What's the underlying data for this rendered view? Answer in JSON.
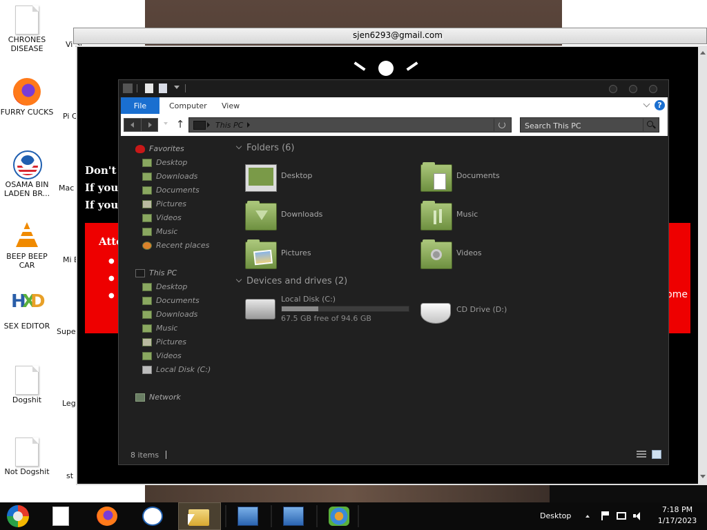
{
  "desktop": {
    "icons": [
      {
        "label": "CHRONES DISEASE",
        "icon": "document-icon"
      },
      {
        "label": "FURRY CUCKS",
        "icon": "firefox-icon"
      },
      {
        "label": "OSAMA BIN LADEN BR...",
        "icon": "obama-logo-icon"
      },
      {
        "label": "BEEP BEEP CAR",
        "icon": "vlc-cone-icon"
      },
      {
        "label": "SEX EDITOR",
        "icon": "hxd-icon"
      },
      {
        "label": "Dogshit",
        "icon": "document-icon"
      },
      {
        "label": "Not Dogshit",
        "icon": "document-icon"
      }
    ],
    "partial_icons": [
      {
        "label": "Vi St",
        "icon": "document-icon"
      },
      {
        "label": "Pi Chi",
        "icon": "image-icon"
      },
      {
        "label": "Mac IN",
        "icon": "app-icon"
      },
      {
        "label": "Mi E",
        "icon": "app-icon"
      },
      {
        "label": "Supe",
        "icon": "document-icon"
      },
      {
        "label": "Leg Ch",
        "icon": "document-icon"
      },
      {
        "label": "st ur",
        "icon": "app-icon"
      }
    ]
  },
  "ransom_window": {
    "title": "sjen6293@gmail.com",
    "lines": [
      "Don't w",
      "If you",
      "If you"
    ],
    "red_box_heading": "Atte",
    "red_box_right_text": "ome",
    "colors": {
      "background": "#000000",
      "box": "#ee0000"
    }
  },
  "explorer": {
    "ribbon": {
      "tabs": [
        "File",
        "Computer",
        "View"
      ],
      "help": "?"
    },
    "address": {
      "location": "This PC"
    },
    "search": {
      "placeholder": "Search This PC"
    },
    "nav": {
      "favorites_label": "Favorites",
      "favorites": [
        "Desktop",
        "Downloads",
        "Documents",
        "Pictures",
        "Videos",
        "Music",
        "Recent places"
      ],
      "thispc_label": "This PC",
      "thispc": [
        "Desktop",
        "Documents",
        "Downloads",
        "Music",
        "Pictures",
        "Videos",
        "Local Disk (C:)"
      ],
      "network_label": "Network"
    },
    "folders_header": "Folders (6)",
    "folders": [
      "Desktop",
      "Documents",
      "Downloads",
      "Music",
      "Pictures",
      "Videos"
    ],
    "drives_header": "Devices and drives (2)",
    "drives": [
      {
        "name": "Local Disk (C:)",
        "free": "67.5 GB free of 94.6 GB",
        "used_fraction": 0.286
      },
      {
        "name": "CD Drive (D:)"
      }
    ],
    "status": {
      "count": "8 items"
    },
    "colors": {
      "accent": "#1a6fd0",
      "window_bg": "#202020"
    }
  },
  "taskbar": {
    "items": [
      "start-icon",
      "document-icon",
      "firefox-icon",
      "obama-logo-icon",
      "file-explorer-icon",
      "network-setup-icon",
      "network-setup-icon",
      "network-gears-icon"
    ],
    "active_item": "file-explorer-icon",
    "desktop_label": "Desktop",
    "time": "7:18 PM",
    "date": "1/17/2023"
  }
}
